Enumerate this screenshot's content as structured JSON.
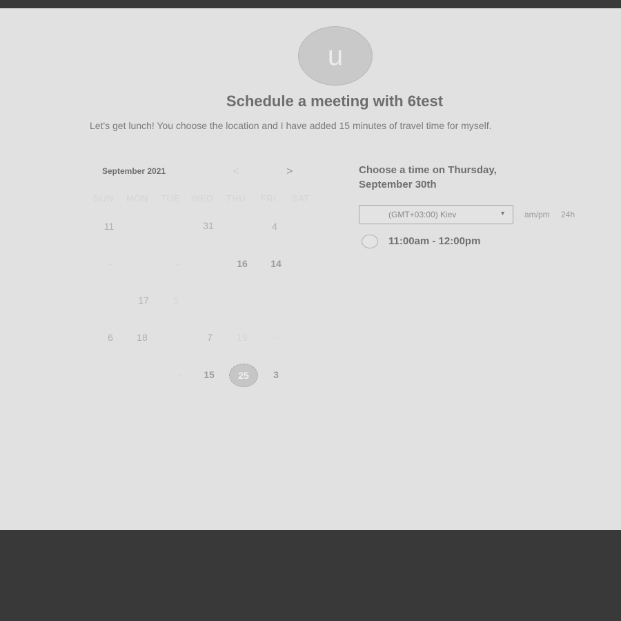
{
  "header": {
    "avatar_initial": "u",
    "title": "Schedule a meeting with 6test",
    "subtitle": "Let's get lunch! You choose the location and I have added 15 minutes of travel time for myself."
  },
  "calendar": {
    "month_label": "September 2021",
    "prev_icon": "<",
    "next_icon": ">",
    "weekdays": [
      "SUN",
      "MON",
      "TUE",
      "WED",
      "THU",
      "FRI",
      "SAT"
    ],
    "days": [
      {
        "label": "11",
        "style": "normal"
      },
      {
        "label": "31",
        "style": "normal"
      },
      {
        "label": "4",
        "style": "normal"
      },
      {
        "label": "-",
        "style": "faint"
      },
      {
        "label": "-",
        "style": "faint"
      },
      {
        "label": "16",
        "style": "bold"
      },
      {
        "label": "14",
        "style": "bold"
      },
      {
        "label": "17",
        "style": "normal"
      },
      {
        "label": "5",
        "style": "faint"
      },
      {
        "label": "6",
        "style": "normal"
      },
      {
        "label": "18",
        "style": "normal"
      },
      {
        "label": "7",
        "style": "normal"
      },
      {
        "label": "19",
        "style": "faint"
      },
      {
        "label": "-",
        "style": "faint"
      },
      {
        "label": "-",
        "style": "faint"
      },
      {
        "label": "15",
        "style": "bold"
      },
      {
        "label": "25",
        "style": "selected"
      },
      {
        "label": "3",
        "style": "bold"
      },
      {
        "label": "-",
        "style": "faint"
      }
    ]
  },
  "time_panel": {
    "heading": "Choose a time on Thursday, September 30th",
    "timezone": "(GMT+03:00) Kiev",
    "format_ampm": "am/pm",
    "format_24h": "24h",
    "slot": "11:00am - 12:00pm"
  },
  "colors": {
    "page_bg": "#e1e1e1",
    "footer_bg": "#393939"
  }
}
